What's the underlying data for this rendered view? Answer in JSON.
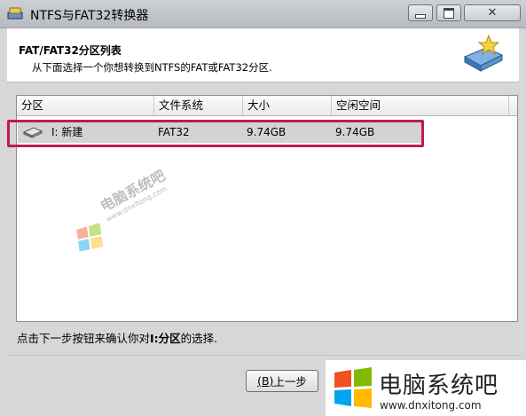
{
  "window": {
    "title": "NTFS与FAT32转换器"
  },
  "header": {
    "title": "FAT/FAT32分区列表",
    "subtitle": "从下面选择一个你想转换到NTFS的FAT或FAT32分区."
  },
  "table": {
    "columns": [
      "分区",
      "文件系统",
      "大小",
      "空闲空间"
    ],
    "rows": [
      {
        "partition": "I: 新建",
        "filesystem": "FAT32",
        "size": "9.74GB",
        "free": "9.74GB"
      }
    ]
  },
  "status": {
    "prefix": "点击下一步按钮来确认你对",
    "bold": "I:分区",
    "suffix": "的选择."
  },
  "buttons": {
    "prev_mnemonic": "(B)",
    "prev_label": "上一步"
  },
  "watermark": {
    "title": "电脑系统吧",
    "url": "www.dnxitong.com"
  },
  "colors": {
    "highlight": "#c2185b"
  }
}
